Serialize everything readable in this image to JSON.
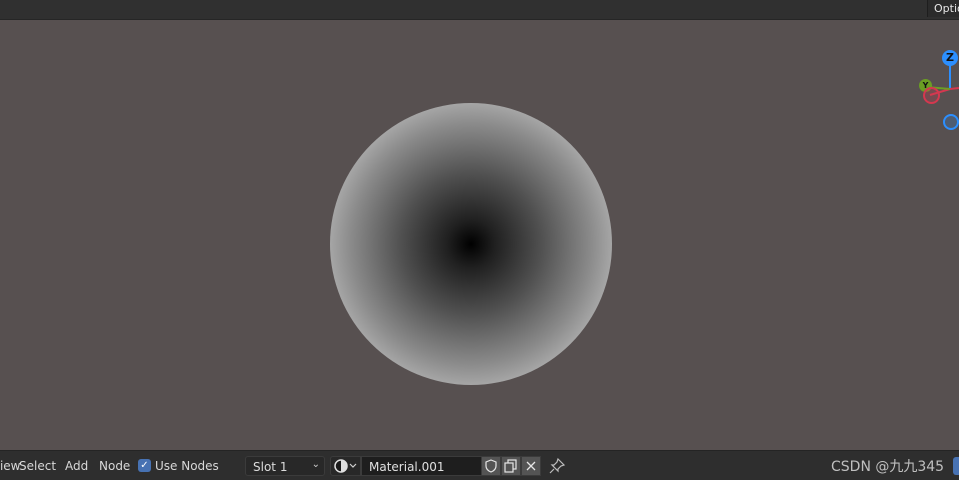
{
  "header": {
    "options_label": "Options"
  },
  "viewport": {
    "gizmo": {
      "z_label": "Z",
      "y_label": "Y"
    }
  },
  "footer": {
    "view_label": "View",
    "select_label": "Select",
    "add_label": "Add",
    "node_label": "Node",
    "use_nodes_label": "Use Nodes",
    "use_nodes_checked": true,
    "slot_value": "Slot 1",
    "material_name": "Material.001",
    "watermark": "CSDN @九九345"
  },
  "colors": {
    "background": "#575050",
    "accent": "#4772b3",
    "axis_x": "#d4384f",
    "axis_y": "#6b9e23",
    "axis_z": "#2c8fff"
  },
  "icons": {
    "checkbox": "checkmark-icon",
    "slot_dropdown": "chevron-down-icon",
    "material_type": "material-sphere-icon",
    "fake_user": "shield-icon",
    "duplicate": "duplicate-icon",
    "unlink": "close-icon",
    "pin": "pin-icon"
  }
}
